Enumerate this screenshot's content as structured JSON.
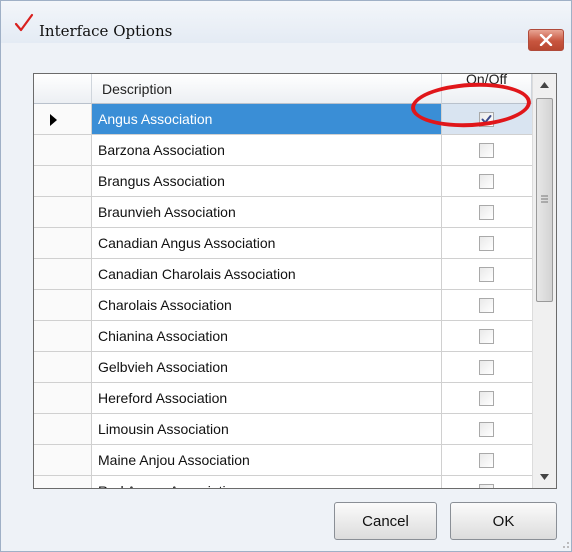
{
  "window": {
    "title": "Interface Options",
    "title_icon": "red-check-icon",
    "close_icon": "close-icon",
    "accent_close_color": "#c8563f"
  },
  "grid": {
    "columns": {
      "description": "Description",
      "onoff": "On/Off"
    },
    "selected_row_color": "#3a8ed6",
    "rows": [
      {
        "description": "Angus Association",
        "checked": true,
        "selected": true
      },
      {
        "description": "Barzona Association",
        "checked": false,
        "selected": false
      },
      {
        "description": "Brangus Association",
        "checked": false,
        "selected": false
      },
      {
        "description": "Braunvieh Association",
        "checked": false,
        "selected": false
      },
      {
        "description": "Canadian Angus Association",
        "checked": false,
        "selected": false
      },
      {
        "description": "Canadian Charolais Association",
        "checked": false,
        "selected": false
      },
      {
        "description": "Charolais Association",
        "checked": false,
        "selected": false
      },
      {
        "description": "Chianina Association",
        "checked": false,
        "selected": false
      },
      {
        "description": "Gelbvieh Association",
        "checked": false,
        "selected": false
      },
      {
        "description": "Hereford Association",
        "checked": false,
        "selected": false
      },
      {
        "description": "Limousin Association",
        "checked": false,
        "selected": false
      },
      {
        "description": "Maine Anjou Association",
        "checked": false,
        "selected": false
      },
      {
        "description": "Red Angus Association",
        "checked": false,
        "selected": false
      }
    ]
  },
  "annotation_color": "#e0161a",
  "buttons": {
    "cancel": "Cancel",
    "ok": "OK"
  }
}
